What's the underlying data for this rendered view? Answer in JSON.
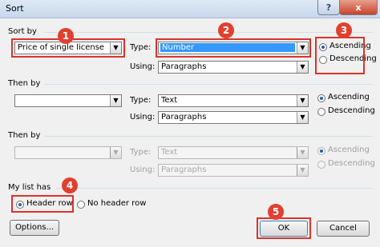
{
  "window": {
    "title": "Sort",
    "help_label": "?",
    "close_label": "x"
  },
  "sort_by": {
    "heading": "Sort by",
    "column_value": "Price of single license",
    "type_label": "Type:",
    "type_value": "Number",
    "using_label": "Using:",
    "using_value": "Paragraphs",
    "ascending_label": "Ascending",
    "descending_label": "Descending",
    "selected_order": "Ascending"
  },
  "then_by_1": {
    "heading": "Then by",
    "column_value": "",
    "type_label": "Type:",
    "type_value": "Text",
    "using_label": "Using:",
    "using_value": "Paragraphs",
    "ascending_label": "Ascending",
    "descending_label": "Descending",
    "selected_order": "Ascending"
  },
  "then_by_2": {
    "heading": "Then by",
    "column_value": "",
    "type_label": "Type:",
    "type_value": "Text",
    "using_label": "Using:",
    "using_value": "Paragraphs",
    "ascending_label": "Ascending",
    "descending_label": "Descending",
    "selected_order": "Ascending",
    "disabled": true
  },
  "list_has": {
    "heading": "My list has",
    "header_row_label": "Header row",
    "no_header_row_label": "No header row",
    "selected": "Header row"
  },
  "buttons": {
    "options": "Options...",
    "ok": "OK",
    "cancel": "Cancel"
  },
  "annotations": {
    "b1": "1",
    "b2": "2",
    "b3": "3",
    "b4": "4",
    "b5": "5",
    "color": "#e0402f"
  }
}
